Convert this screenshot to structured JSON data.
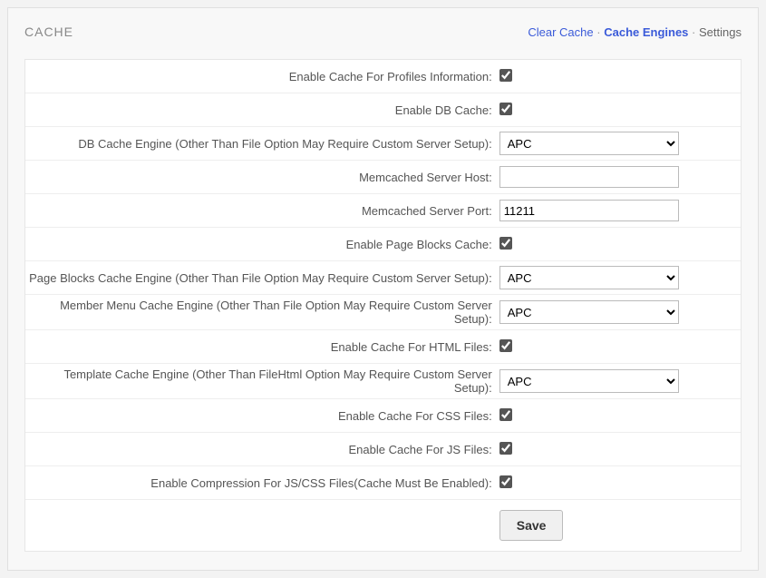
{
  "panel": {
    "title": "CACHE",
    "links": {
      "clear_cache": "Clear Cache",
      "cache_engines": "Cache Engines",
      "settings": "Settings",
      "sep": "·"
    }
  },
  "form": {
    "rows": [
      {
        "id": "enable-profiles",
        "label": "Enable Cache For Profiles Information:",
        "type": "checkbox",
        "checked": true
      },
      {
        "id": "enable-db",
        "label": "Enable DB Cache:",
        "type": "checkbox",
        "checked": true
      },
      {
        "id": "db-engine",
        "label": "DB Cache Engine (Other Than File Option May Require Custom Server Setup):",
        "type": "select",
        "value": "APC"
      },
      {
        "id": "memcached-host",
        "label": "Memcached Server Host:",
        "type": "text",
        "value": ""
      },
      {
        "id": "memcached-port",
        "label": "Memcached Server Port:",
        "type": "text",
        "value": "11211"
      },
      {
        "id": "enable-pageblocks",
        "label": "Enable Page Blocks Cache:",
        "type": "checkbox",
        "checked": true
      },
      {
        "id": "pageblocks-engine",
        "label": "Page Blocks Cache Engine (Other Than File Option May Require Custom Server Setup):",
        "type": "select",
        "value": "APC"
      },
      {
        "id": "membermenu-engine",
        "label": "Member Menu Cache Engine (Other Than File Option May Require Custom Server Setup):",
        "type": "select",
        "value": "APC"
      },
      {
        "id": "enable-html",
        "label": "Enable Cache For HTML Files:",
        "type": "checkbox",
        "checked": true
      },
      {
        "id": "template-engine",
        "label": "Template Cache Engine (Other Than FileHtml Option May Require Custom Server Setup):",
        "type": "select",
        "value": "APC"
      },
      {
        "id": "enable-css",
        "label": "Enable Cache For CSS Files:",
        "type": "checkbox",
        "checked": true
      },
      {
        "id": "enable-js",
        "label": "Enable Cache For JS Files:",
        "type": "checkbox",
        "checked": true
      },
      {
        "id": "enable-compression",
        "label": "Enable Compression For JS/CSS Files(Cache Must Be Enabled):",
        "type": "checkbox",
        "checked": true
      }
    ],
    "save_label": "Save"
  }
}
